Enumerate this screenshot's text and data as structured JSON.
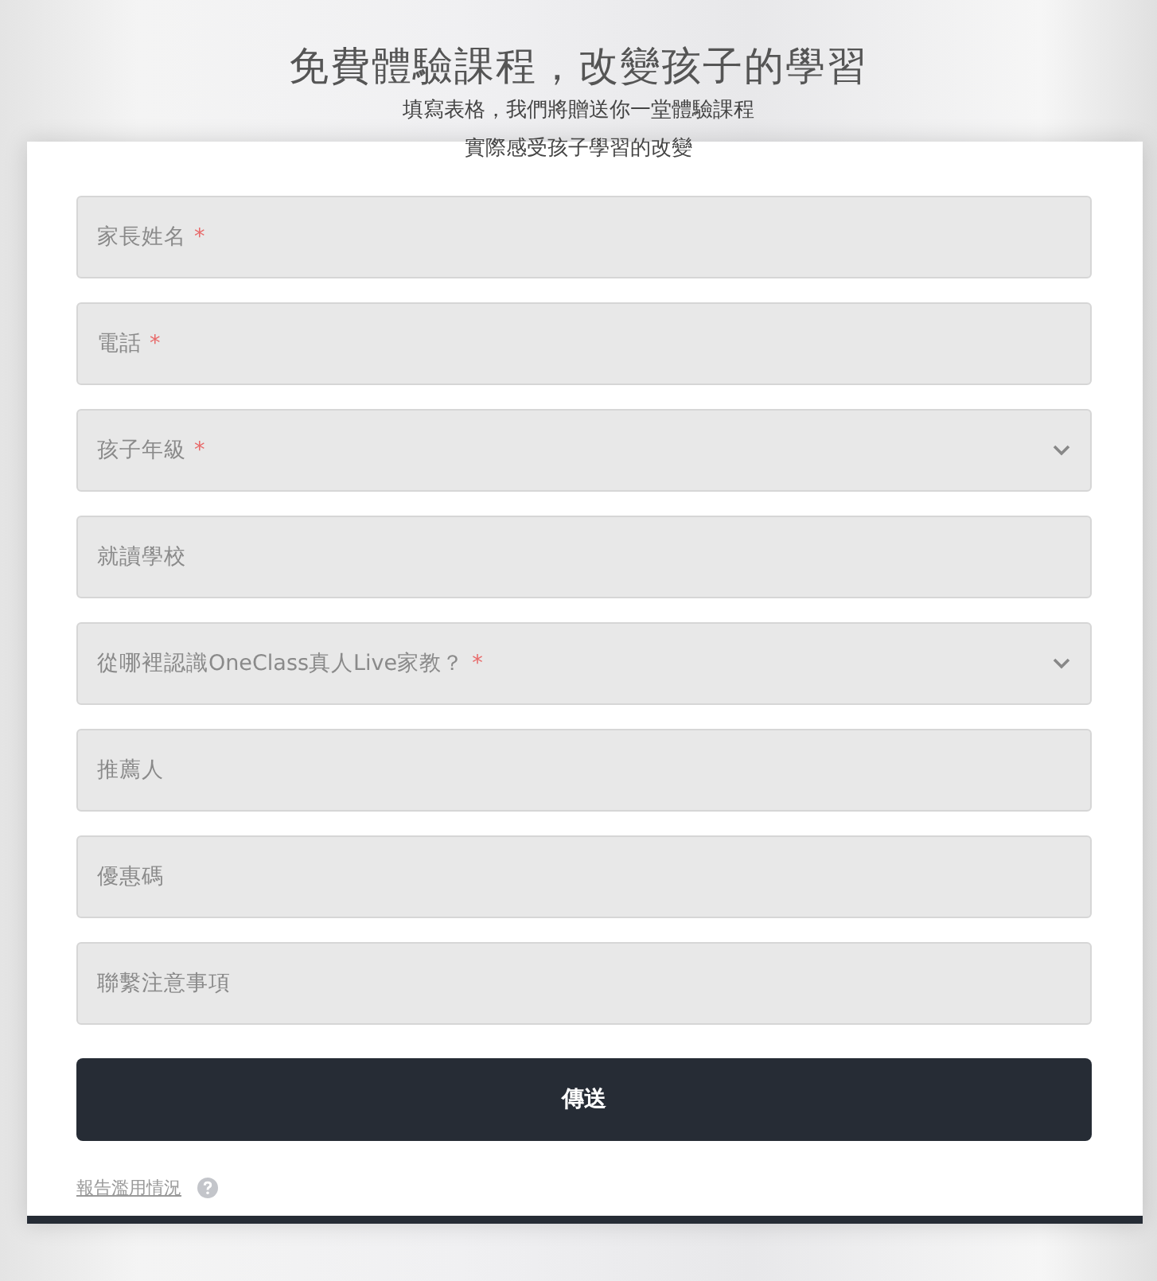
{
  "header": {
    "title": "免費體驗課程，改變孩子的學習",
    "subtitle_lines": [
      "填寫表格，我們將贈送你一堂體驗課程",
      "實際感受孩子學習的改變"
    ]
  },
  "form": {
    "fields": [
      {
        "kind": "text",
        "placeholder": "家長姓名",
        "required_mark": "*"
      },
      {
        "kind": "text",
        "placeholder": "電話",
        "required_mark": "*"
      },
      {
        "kind": "select",
        "placeholder": "孩子年級",
        "required_mark": "*"
      },
      {
        "kind": "text",
        "placeholder": "就讀學校"
      },
      {
        "kind": "select",
        "placeholder": "從哪裡認識OneClass真人Live家教？",
        "required_mark": "*"
      },
      {
        "kind": "text",
        "placeholder": "推薦人"
      },
      {
        "kind": "text",
        "placeholder": "優惠碼"
      },
      {
        "kind": "text",
        "placeholder": "聯繫注意事項"
      }
    ],
    "submit": "傳送",
    "report_link": "報告濫用情況"
  }
}
